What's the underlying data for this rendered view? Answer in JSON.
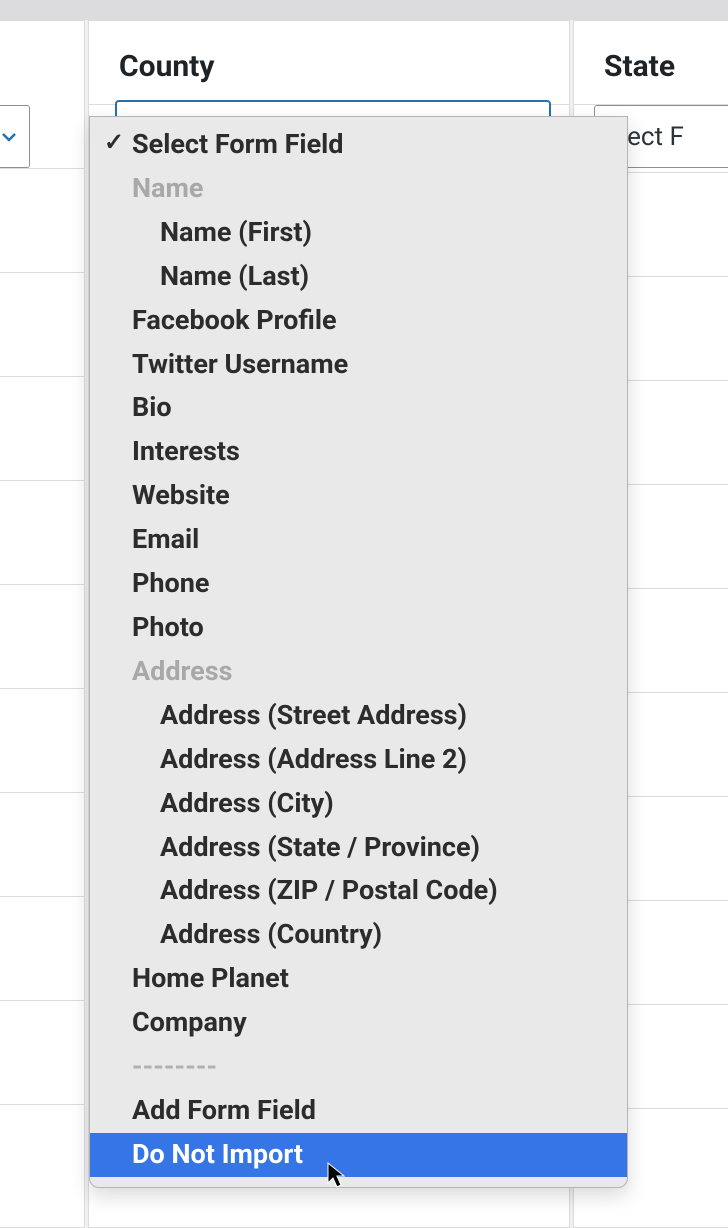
{
  "columns": {
    "left_partial_label": "",
    "middle_label": "County",
    "right_label": "State",
    "right_select_text": "elect F"
  },
  "dropdown": {
    "selected": "Select Form Field",
    "name_group": "Name",
    "name_first": "Name (First)",
    "name_last": "Name (Last)",
    "facebook": "Facebook Profile",
    "twitter": "Twitter Username",
    "bio": "Bio",
    "interests": "Interests",
    "website": "Website",
    "email": "Email",
    "phone": "Phone",
    "photo": "Photo",
    "address_group": "Address",
    "address_street": "Address (Street Address)",
    "address_line2": "Address (Address Line 2)",
    "address_city": "Address (City)",
    "address_state": "Address (State / Province)",
    "address_zip": "Address (ZIP / Postal Code)",
    "address_country": "Address (Country)",
    "home_planet": "Home Planet",
    "company": "Company",
    "separator": "--------",
    "add_form_field": "Add Form Field",
    "do_not_import": "Do Not Import"
  }
}
